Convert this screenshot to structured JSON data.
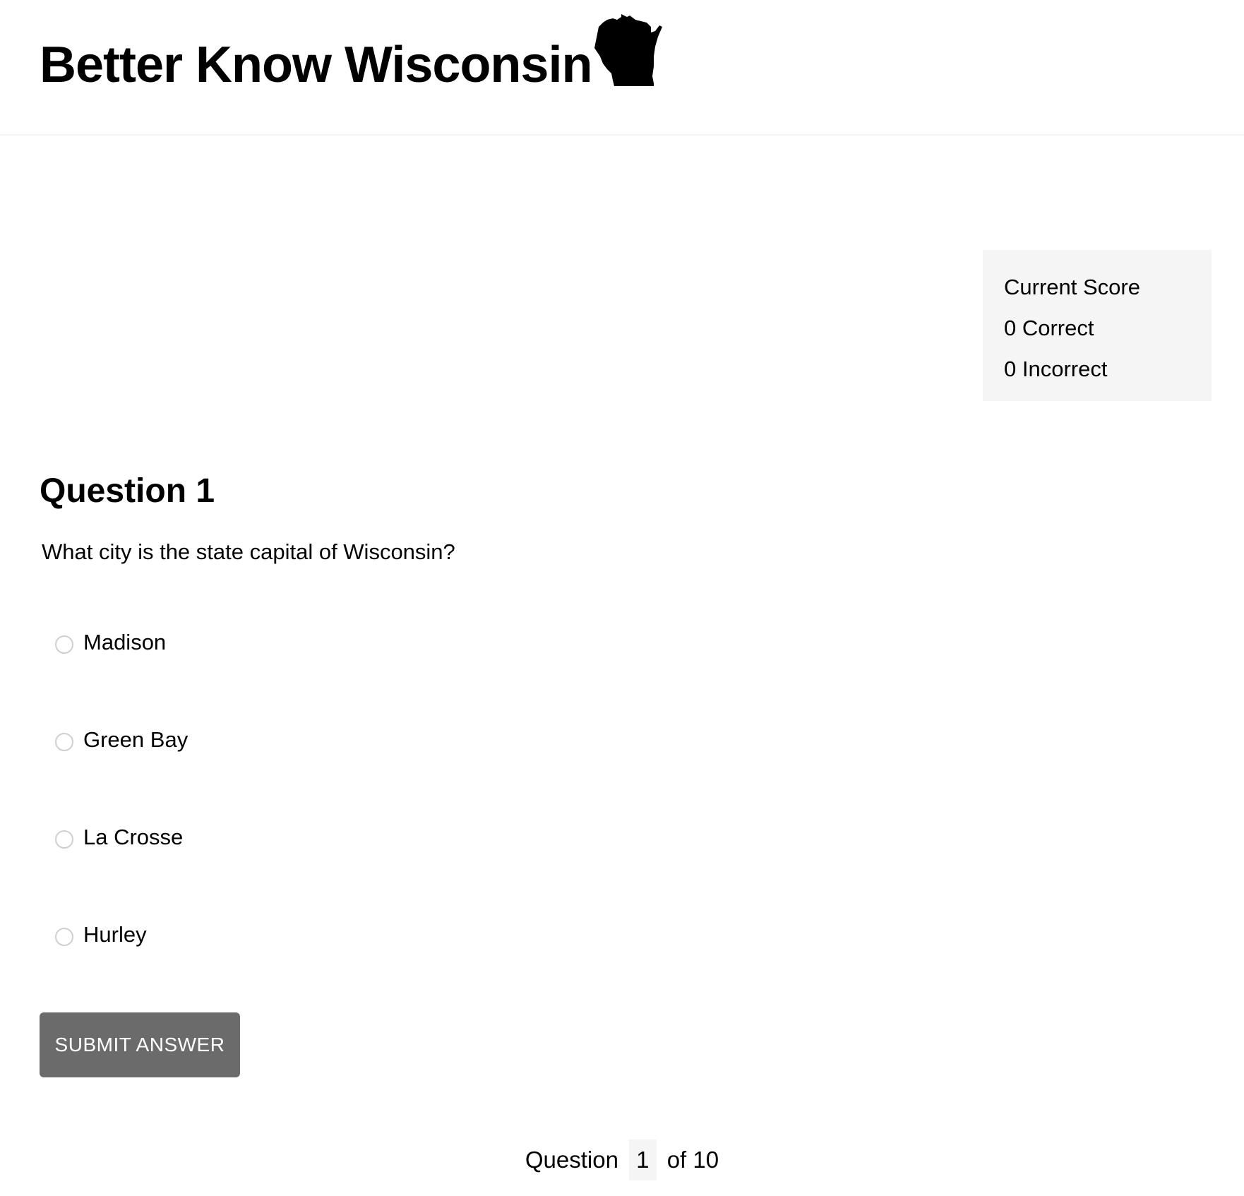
{
  "header": {
    "title": "Better Know Wisconsin",
    "logo_icon": "wisconsin-state-silhouette-icon"
  },
  "score": {
    "heading": "Current Score",
    "correct": "0 Correct",
    "incorrect": "0 Incorrect"
  },
  "question": {
    "heading": "Question 1",
    "text": "What city is the state capital of Wisconsin?",
    "options": [
      {
        "label": "Madison",
        "selected": false
      },
      {
        "label": "Green Bay",
        "selected": false
      },
      {
        "label": "La Crosse",
        "selected": false
      },
      {
        "label": "Hurley",
        "selected": false
      }
    ]
  },
  "actions": {
    "submit_label": "SUBMIT ANSWER"
  },
  "pagination": {
    "prefix": "Question",
    "current": "1",
    "suffix": "of 10"
  },
  "colors": {
    "button_bg": "#6b6b6b",
    "button_text": "#ffffff",
    "score_bg": "#f5f5f5",
    "text": "#000000"
  }
}
